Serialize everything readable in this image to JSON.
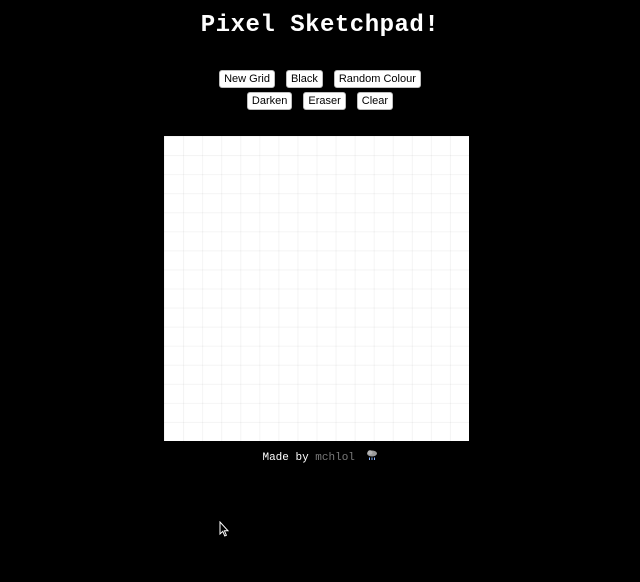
{
  "header": {
    "title": "Pixel Sketchpad!"
  },
  "toolbar": {
    "new_grid_label": "New Grid",
    "black_label": "Black",
    "random_colour_label": "Random Colour",
    "darken_label": "Darken",
    "eraser_label": "Eraser",
    "clear_label": "Clear"
  },
  "grid": {
    "rows": 16,
    "columns": 16,
    "fill_color": "#ffffff"
  },
  "footer": {
    "made_by_text": "Made by",
    "author": "mchlol",
    "icon": "cloud-rain-icon"
  },
  "colors": {
    "background": "#000000",
    "text": "#ffffff",
    "author_link": "#7a7a7a"
  }
}
